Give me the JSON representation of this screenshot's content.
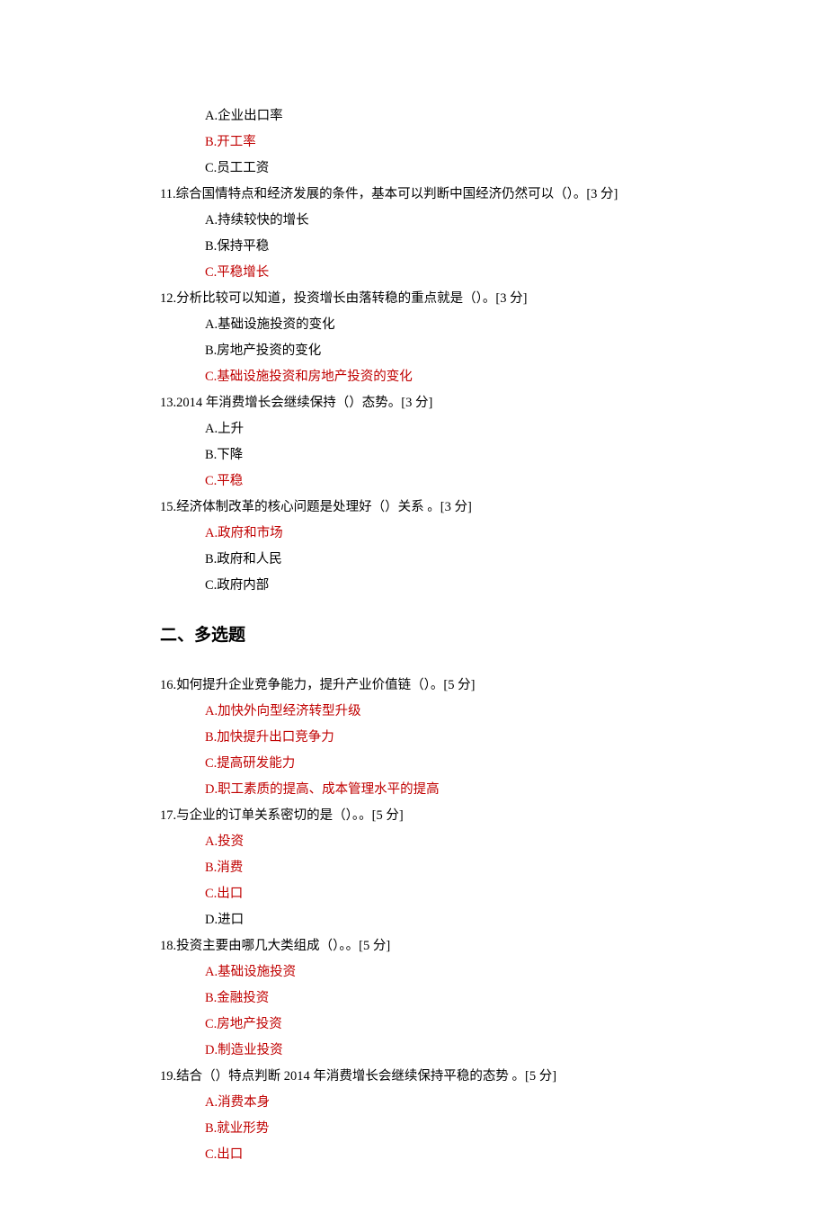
{
  "single": [
    {
      "stem": "",
      "options": [
        {
          "text": "A.企业出口率",
          "correct": false
        },
        {
          "text": "B.开工率",
          "correct": true
        },
        {
          "text": "C.员工工资",
          "correct": false
        }
      ]
    },
    {
      "stem": "11.综合国情特点和经济发展的条件，基本可以判断中国经济仍然可以（）。[3 分]",
      "options": [
        {
          "text": "A.持续较快的增长",
          "correct": false
        },
        {
          "text": "B.保持平稳",
          "correct": false
        },
        {
          "text": "C.平稳增长",
          "correct": true
        }
      ]
    },
    {
      "stem": "12.分析比较可以知道，投资增长由落转稳的重点就是（）。[3 分]",
      "options": [
        {
          "text": "A.基础设施投资的变化",
          "correct": false
        },
        {
          "text": "B.房地产投资的变化",
          "correct": false
        },
        {
          "text": "C.基础设施投资和房地产投资的变化",
          "correct": true
        }
      ]
    },
    {
      "stem": "13.2014 年消费增长会继续保持（）态势。[3 分]",
      "options": [
        {
          "text": "A.上升",
          "correct": false
        },
        {
          "text": "B.下降",
          "correct": false
        },
        {
          "text": "C.平稳",
          "correct": true
        }
      ]
    },
    {
      "stem": "15.经济体制改革的核心问题是处理好（）关系 。[3 分]",
      "options": [
        {
          "text": "A.政府和市场",
          "correct": true
        },
        {
          "text": "B.政府和人民",
          "correct": false
        },
        {
          "text": "C.政府内部",
          "correct": false
        }
      ]
    }
  ],
  "section2_title": "二、多选题",
  "multi": [
    {
      "stem": "16.如何提升企业竞争能力，提升产业价值链（）。[5 分]",
      "options": [
        {
          "text": "A.加快外向型经济转型升级",
          "correct": true
        },
        {
          "text": "B.加快提升出口竞争力",
          "correct": true
        },
        {
          "text": "C.提高研发能力",
          "correct": true
        },
        {
          "text": "D.职工素质的提高、成本管理水平的提高",
          "correct": true
        }
      ]
    },
    {
      "stem": "17.与企业的订单关系密切的是（）。。[5 分]",
      "options": [
        {
          "text": "A.投资",
          "correct": true
        },
        {
          "text": "B.消费",
          "correct": true
        },
        {
          "text": "C.出口",
          "correct": true
        },
        {
          "text": "D.进口",
          "correct": false
        }
      ]
    },
    {
      "stem": "18.投资主要由哪几大类组成（）。。[5 分]",
      "options": [
        {
          "text": "A.基础设施投资",
          "correct": true
        },
        {
          "text": "B.金融投资",
          "correct": true
        },
        {
          "text": "C.房地产投资",
          "correct": true
        },
        {
          "text": "D.制造业投资",
          "correct": true
        }
      ]
    },
    {
      "stem": "19.结合（）特点判断 2014 年消费增长会继续保持平稳的态势 。[5 分]",
      "options": [
        {
          "text": "A.消费本身",
          "correct": true
        },
        {
          "text": "B.就业形势",
          "correct": true
        },
        {
          "text": "C.出口",
          "correct": true
        }
      ]
    }
  ]
}
